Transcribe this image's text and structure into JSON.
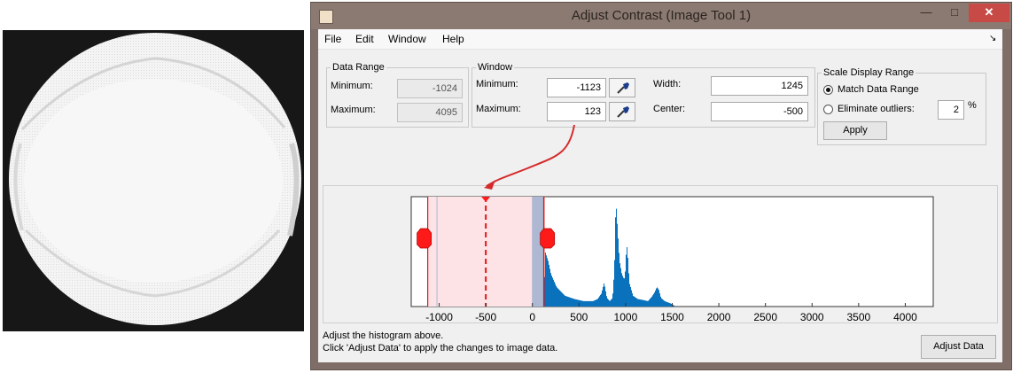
{
  "window": {
    "title": "Adjust Contrast (Image Tool 1)"
  },
  "caption_buttons": {
    "minimize": "—",
    "maximize": "□",
    "close": "✕"
  },
  "menu": [
    "File",
    "Edit",
    "Window",
    "Help"
  ],
  "data_range": {
    "legend": "Data Range",
    "min_label": "Minimum:",
    "min_value": "-1024",
    "max_label": "Maximum:",
    "max_value": "4095"
  },
  "window_group": {
    "legend": "Window",
    "min_label": "Minimum:",
    "min_value": "-1123",
    "max_label": "Maximum:",
    "max_value": "123",
    "width_label": "Width:",
    "width_value": "1245",
    "center_label": "Center:",
    "center_value": "-500"
  },
  "scale_display": {
    "legend": "Scale Display Range",
    "match_label": "Match Data Range",
    "outliers_label": "Eliminate outliers:",
    "outliers_value": "2",
    "percent": "%",
    "apply_label": "Apply",
    "selected": "match"
  },
  "histogram": {
    "xlim": [
      -1300,
      4300
    ],
    "ticks": [
      -1000,
      -500,
      0,
      500,
      1000,
      1500,
      2000,
      2500,
      3000,
      3500,
      4000
    ],
    "tick_labels": [
      "-1000",
      "-500",
      "0",
      "500",
      "1000",
      "1500",
      "2000",
      "2500",
      "3000",
      "3500",
      "4000"
    ],
    "window_min": -1123,
    "window_max": 123,
    "center": -500,
    "data_min": -1024,
    "data_max": 4095,
    "profile": [
      [
        120,
        0.0
      ],
      [
        140,
        0.5
      ],
      [
        170,
        0.42
      ],
      [
        200,
        0.3
      ],
      [
        260,
        0.18
      ],
      [
        350,
        0.1
      ],
      [
        450,
        0.07
      ],
      [
        550,
        0.05
      ],
      [
        650,
        0.05
      ],
      [
        700,
        0.07
      ],
      [
        740,
        0.12
      ],
      [
        770,
        0.22
      ],
      [
        800,
        0.08
      ],
      [
        830,
        0.05
      ],
      [
        860,
        0.08
      ],
      [
        880,
        0.35
      ],
      [
        890,
        0.75
      ],
      [
        895,
        1.0
      ],
      [
        900,
        0.92
      ],
      [
        915,
        0.7
      ],
      [
        935,
        0.42
      ],
      [
        960,
        0.3
      ],
      [
        985,
        0.25
      ],
      [
        1000,
        0.35
      ],
      [
        1010,
        0.58
      ],
      [
        1020,
        0.52
      ],
      [
        1040,
        0.22
      ],
      [
        1080,
        0.1
      ],
      [
        1130,
        0.07
      ],
      [
        1190,
        0.06
      ],
      [
        1240,
        0.05
      ],
      [
        1280,
        0.09
      ],
      [
        1310,
        0.13
      ],
      [
        1335,
        0.18
      ],
      [
        1355,
        0.16
      ],
      [
        1380,
        0.08
      ],
      [
        1420,
        0.05
      ],
      [
        1480,
        0.03
      ],
      [
        1540,
        0.0
      ]
    ],
    "colors": {
      "bars": "#0a72bd",
      "window": "#fde3e6",
      "window_line": "#e11717",
      "handle": "#ff1a1a",
      "overlap": "#93a9cc"
    }
  },
  "status": {
    "line1": "Adjust the histogram above.",
    "line2": "Click 'Adjust Data' to apply the changes to image data."
  },
  "adjust_data_label": "Adjust Data",
  "colors": {
    "annotation_arrow": "#d52b2b"
  }
}
